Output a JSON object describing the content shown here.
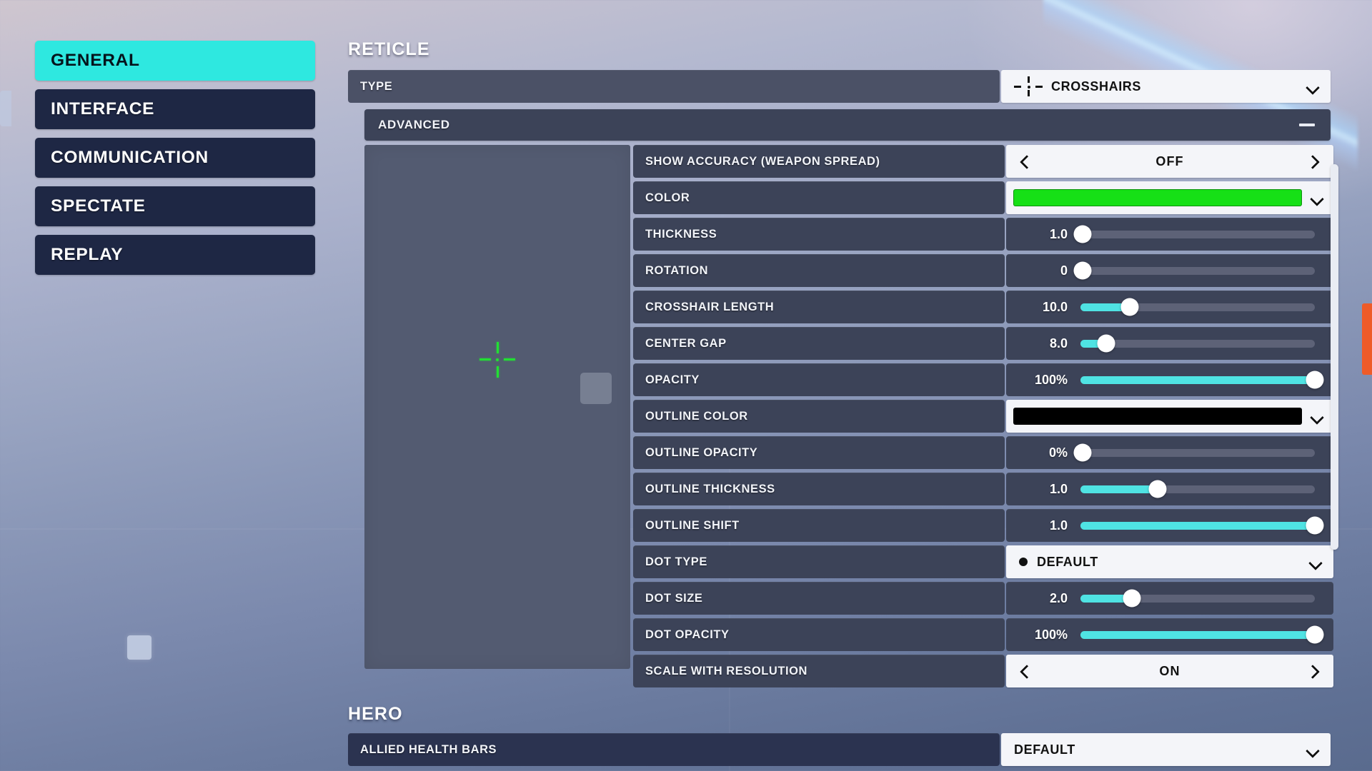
{
  "sidebar": {
    "items": [
      {
        "label": "GENERAL",
        "active": true
      },
      {
        "label": "INTERFACE",
        "active": false
      },
      {
        "label": "COMMUNICATION",
        "active": false
      },
      {
        "label": "SPECTATE",
        "active": false
      },
      {
        "label": "REPLAY",
        "active": false
      }
    ]
  },
  "sections": {
    "reticle_title": "RETICLE",
    "hero_title": "HERO"
  },
  "type_row": {
    "label": "TYPE",
    "value": "CROSSHAIRS",
    "icon": "crosshairs-icon",
    "chevron": "chevron-down-icon"
  },
  "advanced": {
    "label": "ADVANCED",
    "collapse_icon": "minus-icon",
    "expanded": true,
    "preview": {
      "crosshair_color": "#22E033",
      "background": "#535B71"
    },
    "rows": [
      {
        "label": "SHOW ACCURACY (WEAPON SPREAD)",
        "type": "arrows",
        "value": "OFF"
      },
      {
        "label": "COLOR",
        "type": "color",
        "value": "#16E016"
      },
      {
        "label": "THICKNESS",
        "type": "slider",
        "value": "1.0",
        "fill_pct": 1
      },
      {
        "label": "ROTATION",
        "type": "slider",
        "value": "0",
        "fill_pct": 1
      },
      {
        "label": "CROSSHAIR LENGTH",
        "type": "slider",
        "value": "10.0",
        "fill_pct": 21
      },
      {
        "label": "CENTER GAP",
        "type": "slider",
        "value": "8.0",
        "fill_pct": 11
      },
      {
        "label": "OPACITY",
        "type": "slider",
        "value": "100%",
        "fill_pct": 100
      },
      {
        "label": "OUTLINE COLOR",
        "type": "color",
        "value": "#000000"
      },
      {
        "label": "OUTLINE OPACITY",
        "type": "slider",
        "value": "0%",
        "fill_pct": 1
      },
      {
        "label": "OUTLINE THICKNESS",
        "type": "slider",
        "value": "1.0",
        "fill_pct": 33
      },
      {
        "label": "OUTLINE SHIFT",
        "type": "slider",
        "value": "1.0",
        "fill_pct": 100
      },
      {
        "label": "DOT TYPE",
        "type": "dropdown",
        "value": "DEFAULT",
        "icon": "dot-icon"
      },
      {
        "label": "DOT SIZE",
        "type": "slider",
        "value": "2.0",
        "fill_pct": 22
      },
      {
        "label": "DOT OPACITY",
        "type": "slider",
        "value": "100%",
        "fill_pct": 100
      },
      {
        "label": "SCALE WITH RESOLUTION",
        "type": "arrows",
        "value": "ON"
      }
    ]
  },
  "hero_row": {
    "label": "ALLIED HEALTH BARS",
    "value": "DEFAULT"
  },
  "colors": {
    "accent_cyan": "#2EE8E0",
    "slider_fill": "#4FE3E3",
    "nav_dark": "#1E2744",
    "row_label": "#4B5166",
    "row_label_dark": "#3C4358",
    "scroll_accent": "#EE5B29"
  }
}
